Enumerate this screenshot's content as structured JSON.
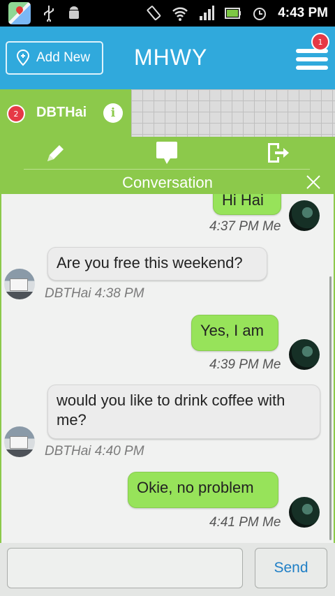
{
  "status_bar": {
    "time": "4:43 PM",
    "icons": [
      "maps-icon",
      "usb-icon",
      "android-icon",
      "vibrate-icon",
      "wifi-icon",
      "signal-icon",
      "battery-icon",
      "alarm-icon"
    ]
  },
  "header": {
    "add_new_label": "Add New",
    "title": "MHWY",
    "menu_badge": "1",
    "color": "#30a9dc"
  },
  "contact": {
    "badge": "2",
    "name": "DBTHai",
    "info_glyph": "i",
    "color": "#8cc94b"
  },
  "tabs": [
    "edit-icon",
    "chat-icon",
    "logout-icon"
  ],
  "conversation": {
    "title": "Conversation",
    "messages": [
      {
        "direction": "out",
        "text": "Hi Hai",
        "meta": "4:37 PM Me"
      },
      {
        "direction": "in",
        "text": "Are you free this weekend?",
        "meta": "DBTHai 4:38 PM"
      },
      {
        "direction": "out",
        "text": "Yes, I am",
        "meta": "4:39 PM Me"
      },
      {
        "direction": "in",
        "text": "would you like to drink coffee with me?",
        "meta": "DBTHai 4:40 PM"
      },
      {
        "direction": "out",
        "text": "Okie, no problem",
        "meta": "4:41 PM Me"
      }
    ]
  },
  "composer": {
    "input_value": "",
    "placeholder": "",
    "send_label": "Send",
    "send_color": "#1f7fc6"
  },
  "bubble_colors": {
    "outgoing": "#97e35a",
    "incoming": "#ececec"
  }
}
